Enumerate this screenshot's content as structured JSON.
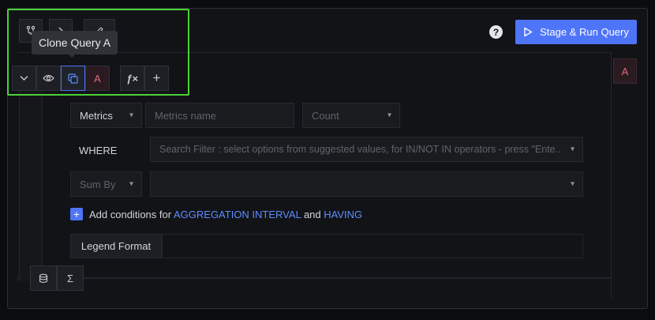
{
  "tooltip": {
    "text": "Clone Query A"
  },
  "header": {
    "help_glyph": "?",
    "run_button_label": "Stage & Run Query",
    "run_button_icon": "play-icon",
    "top_icons": [
      "branch-icon",
      "chevron-right-icon",
      "edit-icon"
    ]
  },
  "query_toolbar": {
    "collapse_icon": "chevron-down-icon",
    "visibility_icon": "eye-icon",
    "clone_icon": "copy-icon",
    "query_letter": "A",
    "formula_glyph": "ƒ×",
    "add_glyph": "+"
  },
  "query_badge": "A",
  "builder": {
    "data_source": {
      "value": "Metrics"
    },
    "metric_name": {
      "placeholder": "Metrics name"
    },
    "aggregate": {
      "value": "Count"
    },
    "where_label": "WHERE",
    "search_filter": {
      "placeholder": "Search Filter : select options from suggested values, for IN/NOT IN operators - press \"Ente.."
    },
    "group_by": {
      "value": "Sum By"
    },
    "group_by_values": {
      "value": ""
    },
    "add_conditions": {
      "prefix": "Add conditions for",
      "aggregation_link": "AGGREGATION INTERVAL",
      "joiner": "and",
      "having_link": "HAVING"
    },
    "legend_format": {
      "label": "Legend Format",
      "value": ""
    }
  },
  "bottom_tools": {
    "data_icon": "database-icon",
    "formula_glyph": "Σ"
  },
  "colors": {
    "accent": "#4e74f8",
    "highlight": "#4cd137",
    "query_letter": "#e06b7d",
    "link": "#5d8dff"
  }
}
